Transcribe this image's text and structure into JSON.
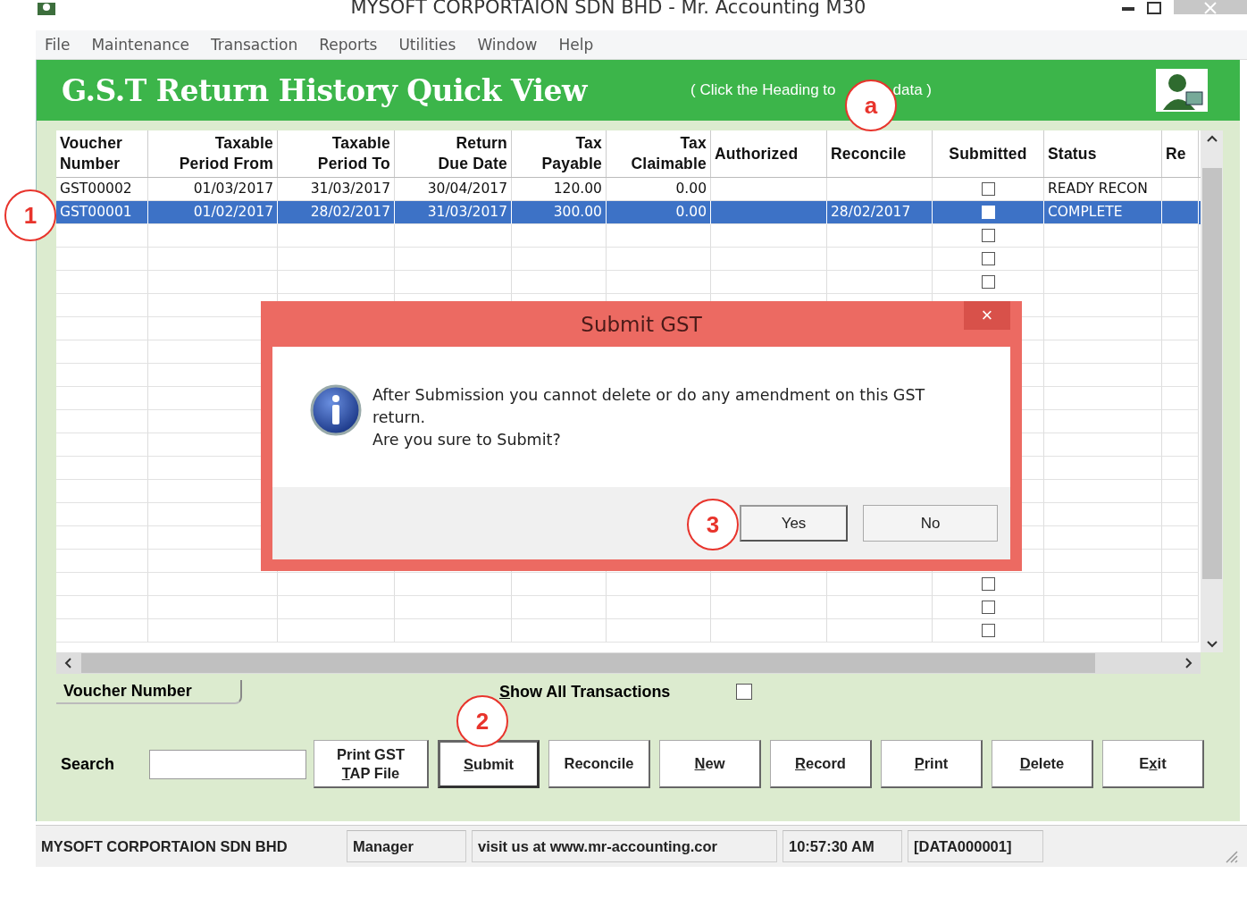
{
  "window": {
    "title": "MYSOFT CORPORTAION SDN BHD - Mr. Accounting M30"
  },
  "menu": [
    "File",
    "Maintenance",
    "Transaction",
    "Reports",
    "Utilities",
    "Window",
    "Help"
  ],
  "header": {
    "title": "G.S.T Return History Quick View",
    "hint_parts": [
      "( Click the Heading to",
      "data )"
    ]
  },
  "table": {
    "columns": [
      "Voucher\nNumber",
      "Taxable\nPeriod From",
      "Taxable\nPeriod To",
      "Return\nDue Date",
      "Tax\nPayable",
      "Tax\nClaimable",
      "Authorized",
      "Reconcile",
      "Submitted",
      "Status",
      "Re"
    ],
    "rows": [
      {
        "selected": false,
        "submitted": false,
        "cells": [
          "GST00002",
          "01/03/2017",
          "31/03/2017",
          "30/04/2017",
          "120.00",
          "0.00",
          null,
          null,
          null,
          "READY RECON",
          null
        ]
      },
      {
        "selected": true,
        "submitted": false,
        "cells": [
          "GST00001",
          "01/02/2017",
          "28/02/2017",
          "31/03/2017",
          "300.00",
          "0.00",
          null,
          "28/02/2017",
          null,
          "COMPLETE",
          null
        ]
      },
      {
        "selected": false,
        "submitted": false
      },
      {
        "selected": false,
        "submitted": false
      },
      {
        "selected": false,
        "submitted": false
      },
      {
        "kind": "hidden"
      },
      {
        "kind": "hidden"
      },
      {
        "kind": "hidden"
      },
      {
        "kind": "hidden"
      },
      {
        "kind": "hidden"
      },
      {
        "kind": "hidden"
      },
      {
        "kind": "hidden"
      },
      {
        "kind": "hidden"
      },
      {
        "kind": "hidden"
      },
      {
        "kind": "hidden"
      },
      {
        "kind": "hidden"
      },
      {
        "kind": "hidden"
      },
      {
        "selected": false,
        "submitted": false
      },
      {
        "selected": false,
        "submitted": false
      },
      {
        "selected": false,
        "submitted": false
      }
    ]
  },
  "sort_label": "Voucher Number",
  "show_all": {
    "key": "S",
    "rest": "how All Transactions",
    "checked": false
  },
  "search": {
    "label": "Search"
  },
  "buttons": [
    {
      "pre": "Print GST\n",
      "key": "T",
      "rest": "AP File",
      "focused": false
    },
    {
      "key": "S",
      "rest": "ubmit",
      "focused": true
    },
    {
      "rest": "Reconcile",
      "focused": false
    },
    {
      "key": "N",
      "rest": "ew",
      "focused": false
    },
    {
      "key": "R",
      "rest": "ecord",
      "focused": false
    },
    {
      "key": "P",
      "rest": "rint",
      "focused": false
    },
    {
      "key": "D",
      "rest": "elete",
      "focused": false
    },
    {
      "pre": "E",
      "key": "x",
      "rest": "it",
      "focused": false
    }
  ],
  "status_bar": [
    "MYSOFT CORPORTAION SDN BHD",
    "Manager",
    "visit us at www.mr-accounting.cor",
    "10:57:30 AM",
    "[DATA000001]"
  ],
  "dialog": {
    "title": "Submit GST",
    "close": "×",
    "message": [
      "After Submission you cannot delete or do any amendment on this GST return.",
      "Are you sure to Submit?"
    ],
    "buttons": [
      "Yes",
      "No"
    ]
  },
  "callouts": [
    "1",
    "a",
    "2",
    "3"
  ]
}
